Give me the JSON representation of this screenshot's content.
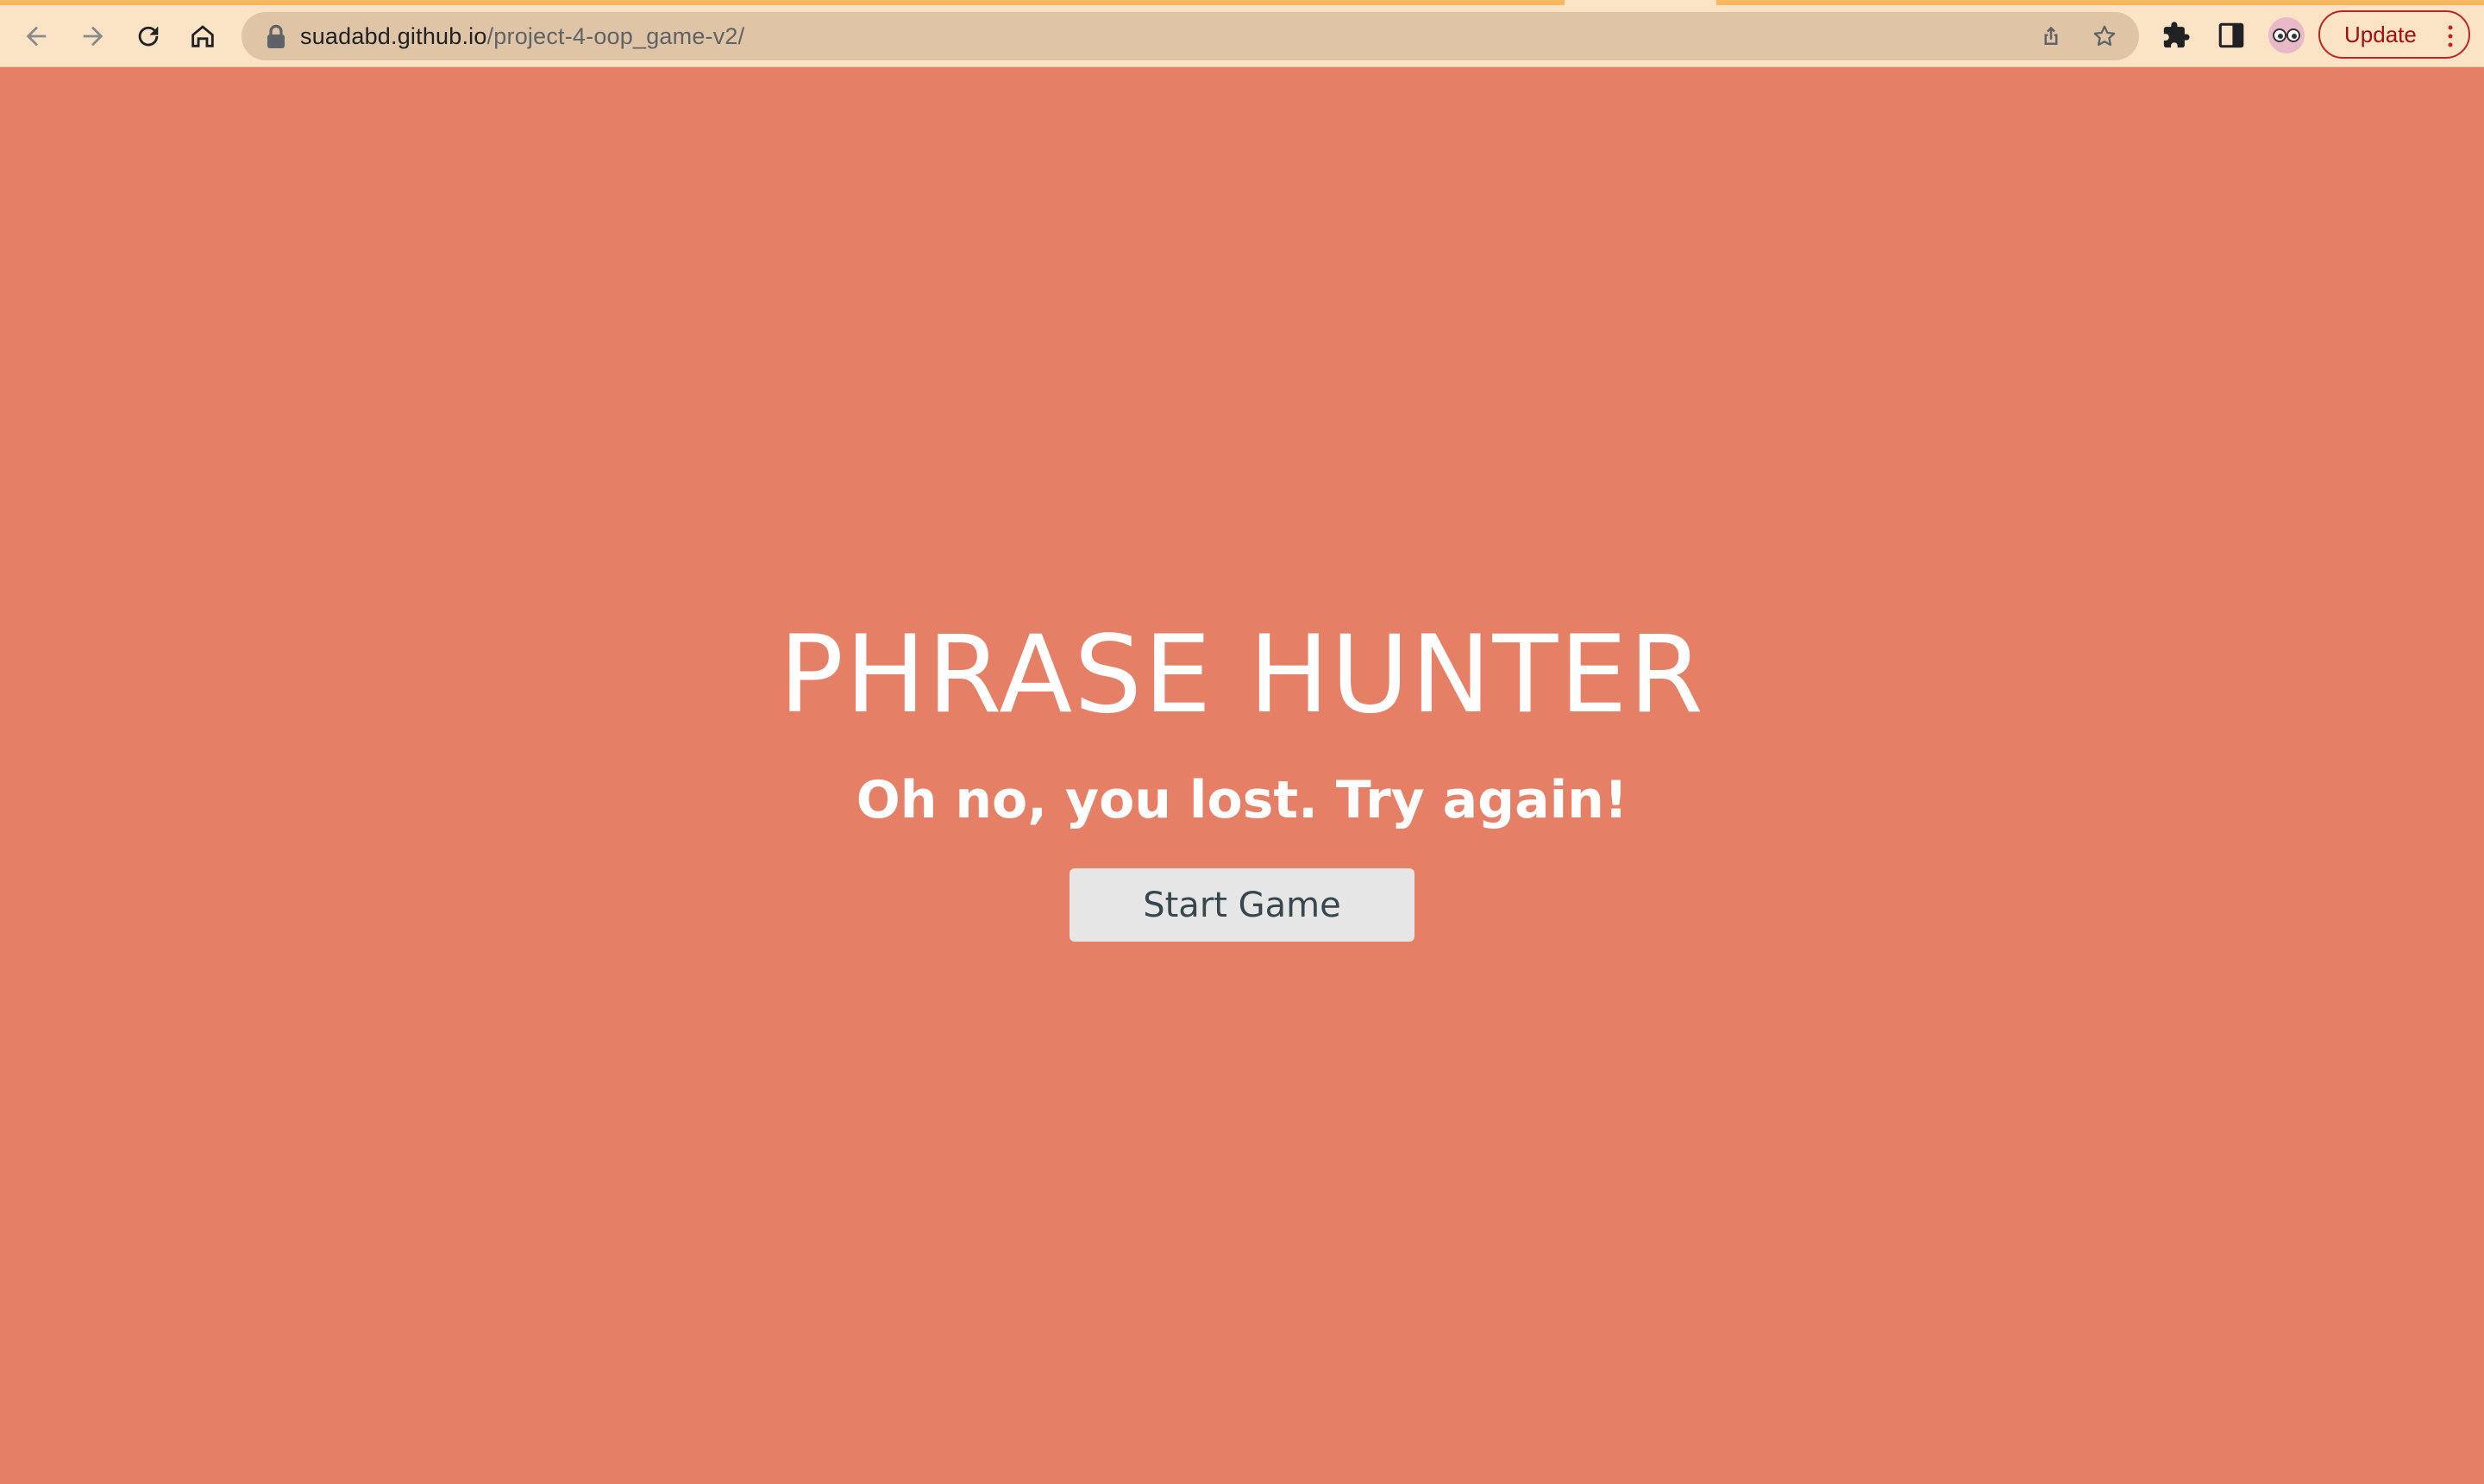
{
  "browser": {
    "url_host": "suadabd.github.io",
    "url_path": "/project-4-oop_game-v2/",
    "update_label": "Update",
    "icons": [
      "back-arrow-icon",
      "forward-arrow-icon",
      "reload-icon",
      "home-icon",
      "lock-icon",
      "share-icon",
      "star-icon",
      "extensions-puzzle-icon",
      "side-panel-icon",
      "profile-avatar-icon",
      "more-vert-icon"
    ]
  },
  "page": {
    "title": "PHRASE HUNTER",
    "message": "Oh no, you lost. Try again!",
    "start_button_label": "Start Game"
  },
  "colors": {
    "overlay_background": "#e57f66",
    "browser_toolbar": "#fbe3c5",
    "omnibox": "#dfc5a6",
    "button_background": "#e6e6e6",
    "button_text": "#37474f",
    "update_accent": "#c5221f"
  }
}
